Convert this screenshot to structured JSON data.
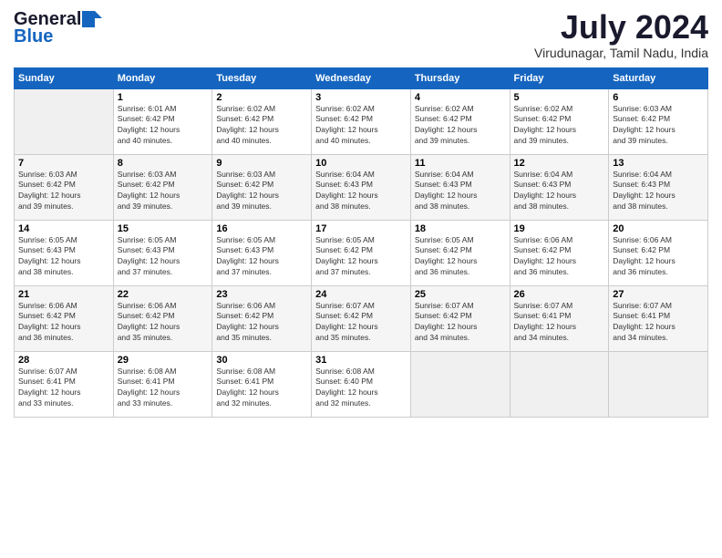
{
  "header": {
    "logo_general": "General",
    "logo_blue": "Blue",
    "title": "July 2024",
    "subtitle": "Virudunagar, Tamil Nadu, India"
  },
  "columns": [
    "Sunday",
    "Monday",
    "Tuesday",
    "Wednesday",
    "Thursday",
    "Friday",
    "Saturday"
  ],
  "weeks": [
    [
      {
        "day": "",
        "info": ""
      },
      {
        "day": "1",
        "info": "Sunrise: 6:01 AM\nSunset: 6:42 PM\nDaylight: 12 hours\nand 40 minutes."
      },
      {
        "day": "2",
        "info": "Sunrise: 6:02 AM\nSunset: 6:42 PM\nDaylight: 12 hours\nand 40 minutes."
      },
      {
        "day": "3",
        "info": "Sunrise: 6:02 AM\nSunset: 6:42 PM\nDaylight: 12 hours\nand 40 minutes."
      },
      {
        "day": "4",
        "info": "Sunrise: 6:02 AM\nSunset: 6:42 PM\nDaylight: 12 hours\nand 39 minutes."
      },
      {
        "day": "5",
        "info": "Sunrise: 6:02 AM\nSunset: 6:42 PM\nDaylight: 12 hours\nand 39 minutes."
      },
      {
        "day": "6",
        "info": "Sunrise: 6:03 AM\nSunset: 6:42 PM\nDaylight: 12 hours\nand 39 minutes."
      }
    ],
    [
      {
        "day": "7",
        "info": "Sunrise: 6:03 AM\nSunset: 6:42 PM\nDaylight: 12 hours\nand 39 minutes."
      },
      {
        "day": "8",
        "info": "Sunrise: 6:03 AM\nSunset: 6:42 PM\nDaylight: 12 hours\nand 39 minutes."
      },
      {
        "day": "9",
        "info": "Sunrise: 6:03 AM\nSunset: 6:42 PM\nDaylight: 12 hours\nand 39 minutes."
      },
      {
        "day": "10",
        "info": "Sunrise: 6:04 AM\nSunset: 6:43 PM\nDaylight: 12 hours\nand 38 minutes."
      },
      {
        "day": "11",
        "info": "Sunrise: 6:04 AM\nSunset: 6:43 PM\nDaylight: 12 hours\nand 38 minutes."
      },
      {
        "day": "12",
        "info": "Sunrise: 6:04 AM\nSunset: 6:43 PM\nDaylight: 12 hours\nand 38 minutes."
      },
      {
        "day": "13",
        "info": "Sunrise: 6:04 AM\nSunset: 6:43 PM\nDaylight: 12 hours\nand 38 minutes."
      }
    ],
    [
      {
        "day": "14",
        "info": "Sunrise: 6:05 AM\nSunset: 6:43 PM\nDaylight: 12 hours\nand 38 minutes."
      },
      {
        "day": "15",
        "info": "Sunrise: 6:05 AM\nSunset: 6:43 PM\nDaylight: 12 hours\nand 37 minutes."
      },
      {
        "day": "16",
        "info": "Sunrise: 6:05 AM\nSunset: 6:43 PM\nDaylight: 12 hours\nand 37 minutes."
      },
      {
        "day": "17",
        "info": "Sunrise: 6:05 AM\nSunset: 6:42 PM\nDaylight: 12 hours\nand 37 minutes."
      },
      {
        "day": "18",
        "info": "Sunrise: 6:05 AM\nSunset: 6:42 PM\nDaylight: 12 hours\nand 36 minutes."
      },
      {
        "day": "19",
        "info": "Sunrise: 6:06 AM\nSunset: 6:42 PM\nDaylight: 12 hours\nand 36 minutes."
      },
      {
        "day": "20",
        "info": "Sunrise: 6:06 AM\nSunset: 6:42 PM\nDaylight: 12 hours\nand 36 minutes."
      }
    ],
    [
      {
        "day": "21",
        "info": "Sunrise: 6:06 AM\nSunset: 6:42 PM\nDaylight: 12 hours\nand 36 minutes."
      },
      {
        "day": "22",
        "info": "Sunrise: 6:06 AM\nSunset: 6:42 PM\nDaylight: 12 hours\nand 35 minutes."
      },
      {
        "day": "23",
        "info": "Sunrise: 6:06 AM\nSunset: 6:42 PM\nDaylight: 12 hours\nand 35 minutes."
      },
      {
        "day": "24",
        "info": "Sunrise: 6:07 AM\nSunset: 6:42 PM\nDaylight: 12 hours\nand 35 minutes."
      },
      {
        "day": "25",
        "info": "Sunrise: 6:07 AM\nSunset: 6:42 PM\nDaylight: 12 hours\nand 34 minutes."
      },
      {
        "day": "26",
        "info": "Sunrise: 6:07 AM\nSunset: 6:41 PM\nDaylight: 12 hours\nand 34 minutes."
      },
      {
        "day": "27",
        "info": "Sunrise: 6:07 AM\nSunset: 6:41 PM\nDaylight: 12 hours\nand 34 minutes."
      }
    ],
    [
      {
        "day": "28",
        "info": "Sunrise: 6:07 AM\nSunset: 6:41 PM\nDaylight: 12 hours\nand 33 minutes."
      },
      {
        "day": "29",
        "info": "Sunrise: 6:08 AM\nSunset: 6:41 PM\nDaylight: 12 hours\nand 33 minutes."
      },
      {
        "day": "30",
        "info": "Sunrise: 6:08 AM\nSunset: 6:41 PM\nDaylight: 12 hours\nand 32 minutes."
      },
      {
        "day": "31",
        "info": "Sunrise: 6:08 AM\nSunset: 6:40 PM\nDaylight: 12 hours\nand 32 minutes."
      },
      {
        "day": "",
        "info": ""
      },
      {
        "day": "",
        "info": ""
      },
      {
        "day": "",
        "info": ""
      }
    ]
  ]
}
